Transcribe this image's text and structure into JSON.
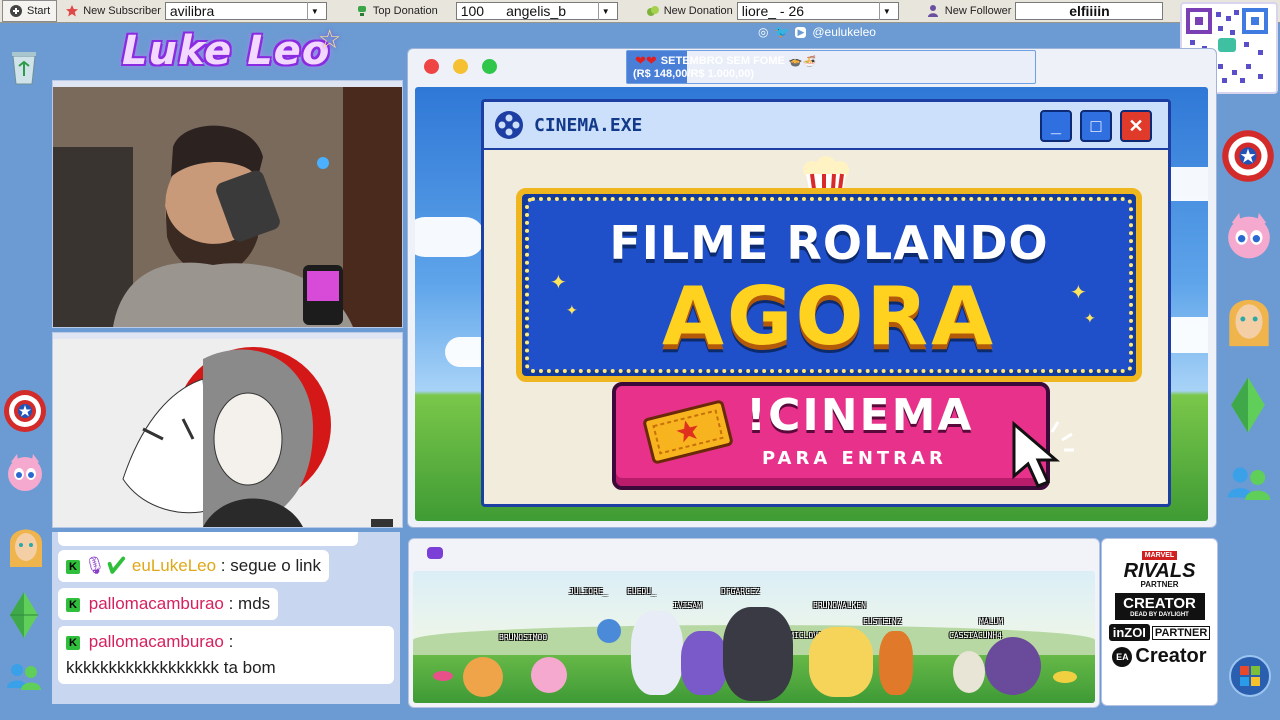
{
  "topbar": {
    "start_label": "Start",
    "new_subscriber_label": "New Subscriber",
    "new_subscriber_value": "avilibra",
    "top_donation_label": "Top Donation",
    "top_donation_amount": "100",
    "top_donation_name": "angelis_b",
    "new_donation_label": "New Donation",
    "new_donation_value": "liore_ - 26",
    "new_follower_label": "New Follower",
    "new_follower_value": "elfiiiin"
  },
  "logo_text": "Luke Leo",
  "main_window": {
    "goal_title": "SETEMBRO SEM FOME",
    "goal_amount": "(R$ 148,00/R$ 1.000,00)",
    "goal_progress": 0.148,
    "social_handle": "@eulukeleo"
  },
  "cinema": {
    "window_title": "CINEMA.EXE",
    "line1": "FILME ROLANDO",
    "line2": "AGORA",
    "command": "!CINEMA",
    "command_sub": "PARA ENTRAR"
  },
  "chat": {
    "messages": [
      {
        "user": "euLukeLeo",
        "text": ": segue o link"
      },
      {
        "user": "pallomacamburao",
        "text": ": mds"
      },
      {
        "user": "pallomacamburao",
        "text": ":"
      },
      {
        "user": "",
        "text": "kkkkkkkkkkkkkkkkkk ta bom"
      }
    ]
  },
  "pokemon_names": [
    "JULIORE_",
    "EUEDU_",
    "IVISAM",
    "DFGARCEZ",
    "BRUNOSIM00",
    "EUCOSMICLOVER",
    "BRUNOWALKEN",
    "EUSTEINZ",
    "CASSIACUNH4",
    "MALUM"
  ],
  "partner": {
    "marvel": "MARVEL",
    "rivals": "RIVALS",
    "rivals_partner": "PARTNER",
    "creator": "CREATOR",
    "dbd": "DEAD BY DAYLIGHT",
    "inzoi": "inZOI",
    "inzoi_partner": "PARTNER",
    "ea_creator": "Creator",
    "ea": "EA"
  },
  "colors": {
    "bg": "#6b9bd2",
    "accent_pink": "#e8318a",
    "marquee_blue": "#1f4fc9",
    "gold": "#ffd21f"
  }
}
